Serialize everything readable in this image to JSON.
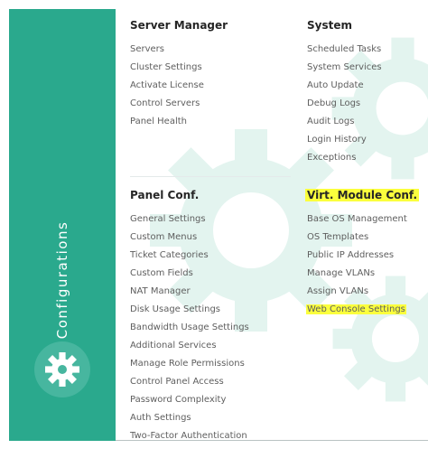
{
  "sidebar": {
    "title": "Configurations",
    "icon": "gear-icon",
    "color": "#2aa98d"
  },
  "sections": {
    "server_manager": {
      "title": "Server Manager",
      "items": [
        "Servers",
        "Cluster Settings",
        "Activate License",
        "Control Servers",
        "Panel Health"
      ]
    },
    "system": {
      "title": "System",
      "items": [
        "Scheduled Tasks",
        "System Services",
        "Auto Update",
        "Debug Logs",
        "Audit Logs",
        "Login History",
        "Exceptions"
      ]
    },
    "panel_conf": {
      "title": "Panel Conf.",
      "items": [
        "General Settings",
        "Custom Menus",
        "Ticket Categories",
        "Custom Fields",
        "NAT Manager",
        "Disk Usage Settings",
        "Bandwidth Usage Settings",
        "Additional Services",
        "Manage Role Permissions",
        "Control Panel Access",
        "Password Complexity",
        "Auth Settings",
        "Two-Factor Authentication"
      ]
    },
    "virt_module_conf": {
      "title": "Virt. Module Conf.",
      "items": [
        "Base OS Management",
        "OS Templates",
        "Public IP Addresses",
        "Manage VLANs",
        "Assign VLANs",
        "Web Console Settings"
      ]
    }
  },
  "highlight_color": "#fbff3d"
}
